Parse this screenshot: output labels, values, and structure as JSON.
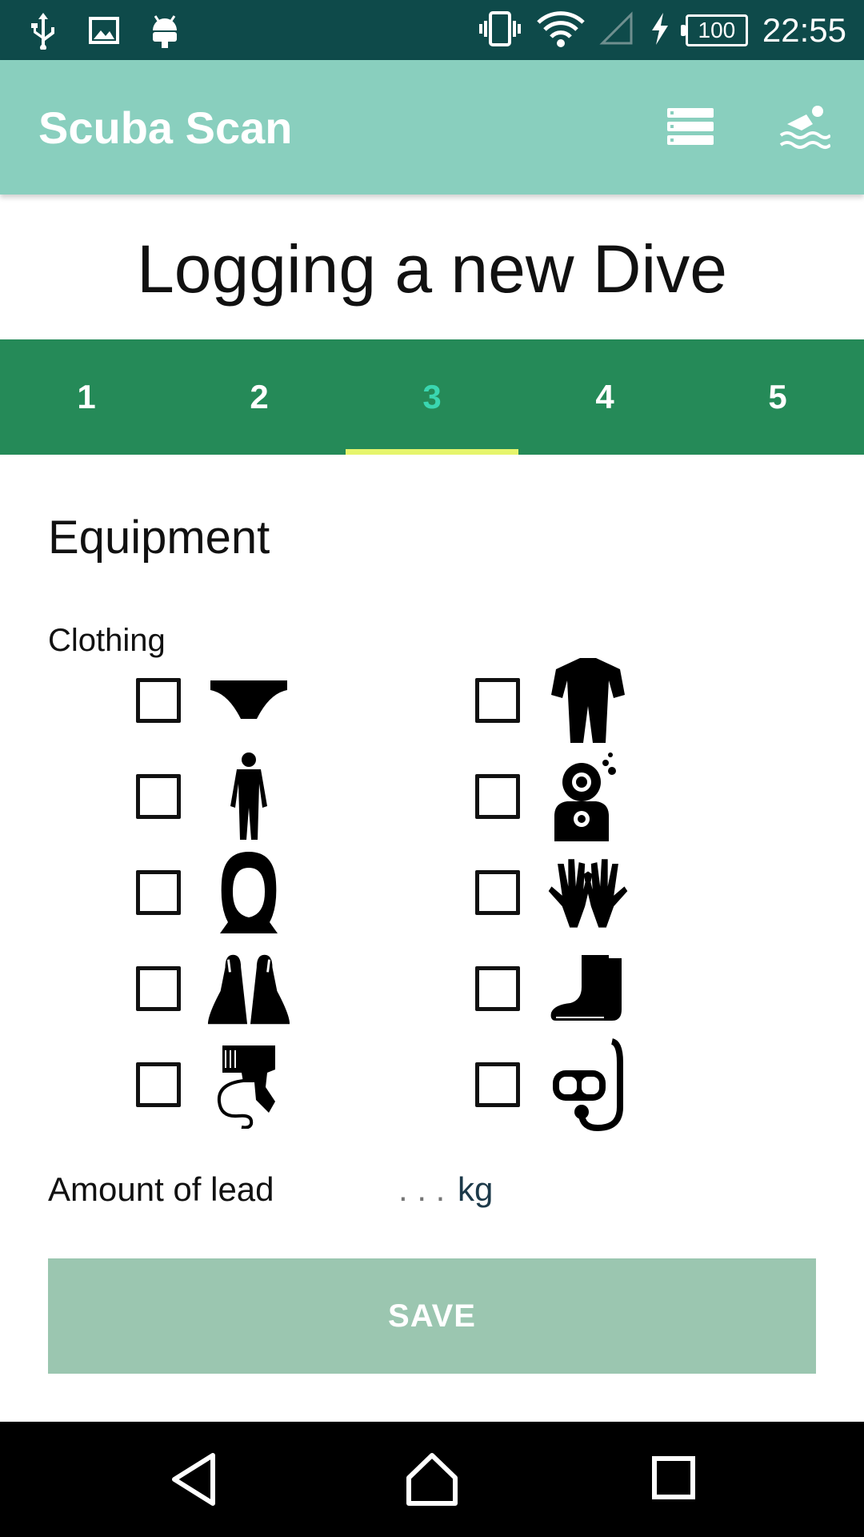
{
  "status_bar": {
    "time": "22:55",
    "battery": "100",
    "left_icons": [
      "usb-icon",
      "image-icon",
      "android-icon"
    ],
    "right_icons": [
      "vibrate-icon",
      "wifi-icon",
      "signal-icon",
      "charging-icon"
    ]
  },
  "app_bar": {
    "title": "Scuba Scan",
    "actions": [
      "list-icon",
      "swimmer-icon"
    ]
  },
  "page": {
    "title": "Logging a new Dive"
  },
  "tabs": {
    "items": [
      {
        "label": "1"
      },
      {
        "label": "2"
      },
      {
        "label": "3"
      },
      {
        "label": "4"
      },
      {
        "label": "5"
      }
    ],
    "active_index": 2
  },
  "equipment": {
    "section_title": "Equipment",
    "clothing_label": "Clothing",
    "items": [
      {
        "icon": "swimsuit-icon",
        "checked": false
      },
      {
        "icon": "shorty-wetsuit-icon",
        "checked": false
      },
      {
        "icon": "full-wetsuit-icon",
        "checked": false
      },
      {
        "icon": "drysuit-helmet-icon",
        "checked": false
      },
      {
        "icon": "hood-icon",
        "checked": false
      },
      {
        "icon": "gloves-icon",
        "checked": false
      },
      {
        "icon": "fins-icon",
        "checked": false
      },
      {
        "icon": "boots-icon",
        "checked": false
      },
      {
        "icon": "regulator-icon",
        "checked": false
      },
      {
        "icon": "mask-snorkel-icon",
        "checked": false
      }
    ],
    "lead": {
      "label": "Amount of lead",
      "placeholder": ". . .",
      "unit": "kg"
    },
    "save_label": "SAVE"
  },
  "colors": {
    "status_bar": "#0e4a4a",
    "app_bar": "#89cfbe",
    "tabs_bg": "#258a58",
    "tab_active_text": "#3ad6b0",
    "tab_indicator": "#e6f56c",
    "save_button": "#9bc6b0",
    "nav_bar": "#000000"
  }
}
